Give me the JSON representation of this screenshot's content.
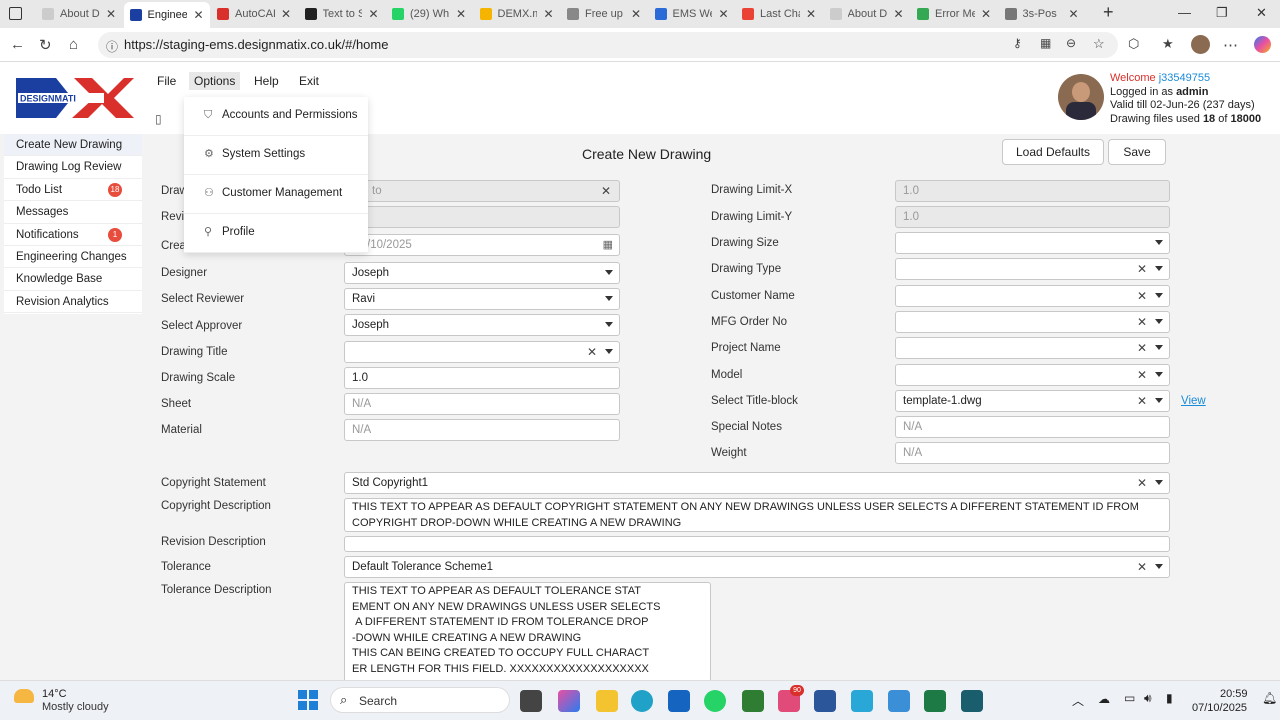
{
  "browser": {
    "tabs": [
      {
        "label": "About D",
        "color": "#ccc"
      },
      {
        "label": "Engineer",
        "color": "#1a3fa0",
        "active": true
      },
      {
        "label": "AutoCAI",
        "color": "#d9302b"
      },
      {
        "label": "Text to S",
        "color": "#222"
      },
      {
        "label": "(29) Wh",
        "color": "#25d366"
      },
      {
        "label": "DEMX.m",
        "color": "#f4b400"
      },
      {
        "label": "Free up",
        "color": "#888"
      },
      {
        "label": "EMS We",
        "color": "#2a6bd8"
      },
      {
        "label": "Last Cha",
        "color": "#ea4335"
      },
      {
        "label": "About D",
        "color": "#ccc"
      },
      {
        "label": "Error Me",
        "color": "#34a853"
      },
      {
        "label": "3s-Pos",
        "color": "#777"
      }
    ],
    "url": "https://staging-ems.designmatix.co.uk/#/home"
  },
  "app": {
    "menu": [
      "File",
      "Options",
      "Help",
      "Exit"
    ],
    "logo_text": "DESIGNMATI",
    "user": {
      "welcome": "Welcome",
      "user_id": "j33549755",
      "logged_prefix": "Logged in as",
      "role": "admin",
      "valid": "Valid till 02-Jun-26 (237 days)",
      "files_prefix": "Drawing files used",
      "files_used": "18",
      "files_of": "of",
      "files_total": "18000"
    }
  },
  "sidebar": {
    "items": [
      {
        "label": "Create New Drawing",
        "active": true,
        "badge": ""
      },
      {
        "label": "Drawing Log Review",
        "badge": ""
      },
      {
        "label": "Todo List",
        "badge": "18"
      },
      {
        "label": "Messages",
        "badge": ""
      },
      {
        "label": "Notifications",
        "badge": "1"
      },
      {
        "label": "Engineering Changes",
        "badge": ""
      },
      {
        "label": "Knowledge Base",
        "badge": ""
      },
      {
        "label": "Revision Analytics",
        "badge": ""
      }
    ]
  },
  "options_menu": {
    "items": [
      {
        "label": "Accounts and Permissions",
        "icon": "shield-icon"
      },
      {
        "label": "System Settings",
        "icon": "gear-icon"
      },
      {
        "label": "Customer Management",
        "icon": "users-icon"
      },
      {
        "label": "Profile",
        "icon": "user-icon"
      }
    ]
  },
  "form": {
    "title": "Create New Drawing",
    "load_defaults": "Load Defaults",
    "save": "Save",
    "left": {
      "drawing_no_label": "Draw",
      "drawing_no_ph": "to",
      "revision_label": "Revis",
      "created_label": "Crea",
      "created_value": "/10/2025",
      "designer_label": "Designer",
      "designer": "Joseph",
      "reviewer_label": "Select Reviewer",
      "reviewer": "Ravi",
      "approver_label": "Select Approver",
      "approver": "Joseph",
      "title_label": "Drawing Title",
      "title": "",
      "scale_label": "Drawing Scale",
      "scale": "1.0",
      "sheet_label": "Sheet",
      "sheet_ph": "N/A",
      "material_label": "Material",
      "material_ph": "N/A"
    },
    "right": {
      "limit_x_label": "Drawing Limit-X",
      "limit_x": "1.0",
      "limit_y_label": "Drawing Limit-Y",
      "limit_y": "1.0",
      "size_label": "Drawing Size",
      "type_label": "Drawing Type",
      "customer_label": "Customer Name",
      "mfg_label": "MFG Order No",
      "project_label": "Project Name",
      "model_label": "Model",
      "titleblock_label": "Select Title-block",
      "titleblock": "template-1.dwg",
      "view_link": "View",
      "notes_label": "Special Notes",
      "notes_ph": "N/A",
      "weight_label": "Weight",
      "weight_ph": "N/A"
    },
    "copyright_label": "Copyright Statement",
    "copyright": "Std Copyright1",
    "copyright_desc_label": "Copyright Description",
    "copyright_desc": "THIS TEXT TO APPEAR AS DEFAULT COPYRIGHT STATEMENT ON ANY NEW DRAWINGS UNLESS USER SELECTS A DIFFERENT STATEMENT ID FROM COPYRIGHT DROP-DOWN WHILE CREATING A NEW DRAWING",
    "revision_desc_label": "Revision Description",
    "tolerance_label": "Tolerance",
    "tolerance": "Default Tolerance Scheme1",
    "tolerance_desc_label": "Tolerance Description",
    "tolerance_desc": "THIS TEXT TO APPEAR AS DEFAULT TOLERANCE STAT\nEMENT ON ANY NEW DRAWINGS UNLESS USER SELECTS\n A DIFFERENT STATEMENT ID FROM TOLERANCE DROP\n-DOWN WHILE CREATING A NEW DRAWING\nTHIS CAN BEING CREATED TO OCCUPY FULL CHARACT\nER LENGTH FOR THIS FIELD. XXXXXXXXXXXXXXXXXXX"
  },
  "taskbar": {
    "weather_temp": "14°C",
    "weather_desc": "Mostly cloudy",
    "search": "Search",
    "time": "20:59",
    "date": "07/10/2025",
    "notif_count": "90"
  }
}
